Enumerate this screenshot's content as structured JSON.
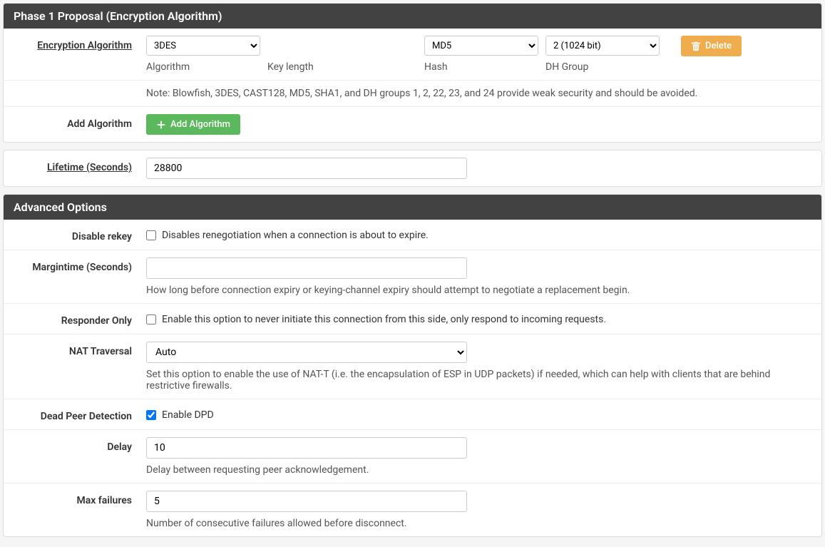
{
  "phase1": {
    "title": "Phase 1 Proposal (Encryption Algorithm)",
    "encryption_label": "Encryption Algorithm",
    "algorithm_value": "3DES",
    "algorithm_sublabel": "Algorithm",
    "keylength_sublabel": "Key length",
    "hash_value": "MD5",
    "hash_sublabel": "Hash",
    "dhgroup_value": "2 (1024 bit)",
    "dhgroup_sublabel": "DH Group",
    "delete_label": "Delete",
    "note": "Note: Blowfish, 3DES, CAST128, MD5, SHA1, and DH groups 1, 2, 22, 23, and 24 provide weak security and should be avoided.",
    "add_algorithm_label": "Add Algorithm",
    "add_algorithm_btn": "Add Algorithm",
    "lifetime_label": "Lifetime (Seconds)",
    "lifetime_value": "28800"
  },
  "advanced": {
    "title": "Advanced Options",
    "disable_rekey_label": "Disable rekey",
    "disable_rekey_text": "Disables renegotiation when a connection is about to expire.",
    "margintime_label": "Margintime (Seconds)",
    "margintime_value": "",
    "margintime_help": "How long before connection expiry or keying-channel expiry should attempt to negotiate a replacement begin.",
    "responder_label": "Responder Only",
    "responder_text": "Enable this option to never initiate this connection from this side, only respond to incoming requests.",
    "nat_label": "NAT Traversal",
    "nat_value": "Auto",
    "nat_help": "Set this option to enable the use of NAT-T (i.e. the encapsulation of ESP in UDP packets) if needed, which can help with clients that are behind restrictive firewalls.",
    "dpd_label": "Dead Peer Detection",
    "dpd_text": "Enable DPD",
    "delay_label": "Delay",
    "delay_value": "10",
    "delay_help": "Delay between requesting peer acknowledgement.",
    "maxfail_label": "Max failures",
    "maxfail_value": "5",
    "maxfail_help": "Number of consecutive failures allowed before disconnect."
  }
}
